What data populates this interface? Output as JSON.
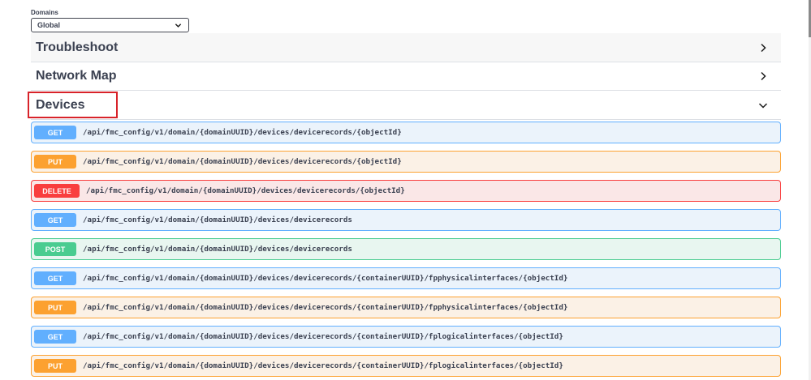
{
  "domains": {
    "label": "Domains",
    "selected": "Global"
  },
  "sections": {
    "troubleshoot": {
      "title": "Troubleshoot"
    },
    "network_map": {
      "title": "Network Map"
    },
    "devices": {
      "title": "Devices"
    }
  },
  "operations": [
    {
      "method": "GET",
      "path": "/api/fmc_config/v1/domain/{domainUUID}/devices/devicerecords/{objectId}"
    },
    {
      "method": "PUT",
      "path": "/api/fmc_config/v1/domain/{domainUUID}/devices/devicerecords/{objectId}"
    },
    {
      "method": "DELETE",
      "path": "/api/fmc_config/v1/domain/{domainUUID}/devices/devicerecords/{objectId}"
    },
    {
      "method": "GET",
      "path": "/api/fmc_config/v1/domain/{domainUUID}/devices/devicerecords"
    },
    {
      "method": "POST",
      "path": "/api/fmc_config/v1/domain/{domainUUID}/devices/devicerecords"
    },
    {
      "method": "GET",
      "path": "/api/fmc_config/v1/domain/{domainUUID}/devices/devicerecords/{containerUUID}/fpphysicalinterfaces/{objectId}"
    },
    {
      "method": "PUT",
      "path": "/api/fmc_config/v1/domain/{domainUUID}/devices/devicerecords/{containerUUID}/fpphysicalinterfaces/{objectId}"
    },
    {
      "method": "GET",
      "path": "/api/fmc_config/v1/domain/{domainUUID}/devices/devicerecords/{containerUUID}/fplogicalinterfaces/{objectId}"
    },
    {
      "method": "PUT",
      "path": "/api/fmc_config/v1/domain/{domainUUID}/devices/devicerecords/{containerUUID}/fplogicalinterfaces/{objectId}"
    }
  ],
  "colors": {
    "get": "#61affe",
    "put": "#fca130",
    "delete": "#f93e3e",
    "post": "#49cc90",
    "highlight": "#d8232a"
  }
}
